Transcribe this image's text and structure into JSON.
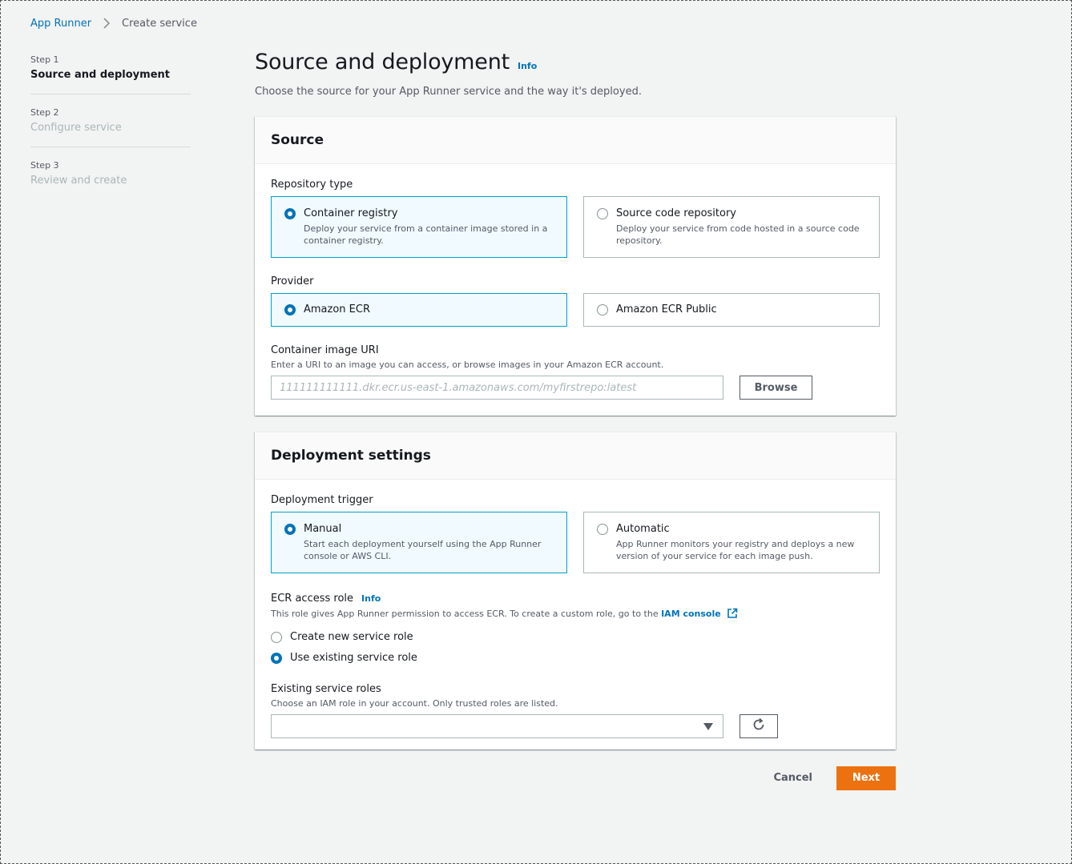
{
  "breadcrumb": {
    "parent": "App Runner",
    "current": "Create service"
  },
  "steps": [
    {
      "number": "Step 1",
      "title": "Source and deployment"
    },
    {
      "number": "Step 2",
      "title": "Configure service"
    },
    {
      "number": "Step 3",
      "title": "Review and create"
    }
  ],
  "page": {
    "title": "Source and deployment",
    "info": "Info",
    "description": "Choose the source for your App Runner service and the way it's deployed."
  },
  "source": {
    "header": "Source",
    "repo_type_label": "Repository type",
    "repo_types": [
      {
        "title": "Container registry",
        "desc": "Deploy your service from a container image stored in a container registry.",
        "selected": true
      },
      {
        "title": "Source code repository",
        "desc": "Deploy your service from code hosted in a source code repository.",
        "selected": false
      }
    ],
    "provider_label": "Provider",
    "providers": [
      {
        "title": "Amazon ECR",
        "selected": true
      },
      {
        "title": "Amazon ECR Public",
        "selected": false
      }
    ],
    "uri_label": "Container image URI",
    "uri_desc": "Enter a URI to an image you can access, or browse images in your Amazon ECR account.",
    "uri_placeholder": "111111111111.dkr.ecr.us-east-1.amazonaws.com/myfirstrepo:latest",
    "browse_label": "Browse"
  },
  "deployment": {
    "header": "Deployment settings",
    "trigger_label": "Deployment trigger",
    "triggers": [
      {
        "title": "Manual",
        "desc": "Start each deployment yourself using the App Runner console or AWS CLI.",
        "selected": true
      },
      {
        "title": "Automatic",
        "desc": "App Runner monitors your registry and deploys a new version of your service for each image push.",
        "selected": false
      }
    ],
    "role_label": "ECR access role",
    "role_info": "Info",
    "role_desc": "This role gives App Runner permission to access ECR. To create a custom role, go to the",
    "iam_link": "IAM console",
    "role_options": [
      {
        "label": "Create new service role",
        "selected": false
      },
      {
        "label": "Use existing service role",
        "selected": true
      }
    ],
    "existing_label": "Existing service roles",
    "existing_desc": "Choose an IAM role in your account. Only trusted roles are listed.",
    "existing_value": ""
  },
  "actions": {
    "cancel": "Cancel",
    "next": "Next"
  },
  "colors": {
    "accent": "#0073bb",
    "primary_button": "#ec7211",
    "selected_border": "#00a1c9",
    "selected_bg": "#f1faff"
  },
  "icons": {
    "breadcrumb_separator": "chevron-right-icon",
    "external_link": "external-link-icon",
    "refresh": "refresh-icon",
    "dropdown": "caret-down-icon"
  }
}
